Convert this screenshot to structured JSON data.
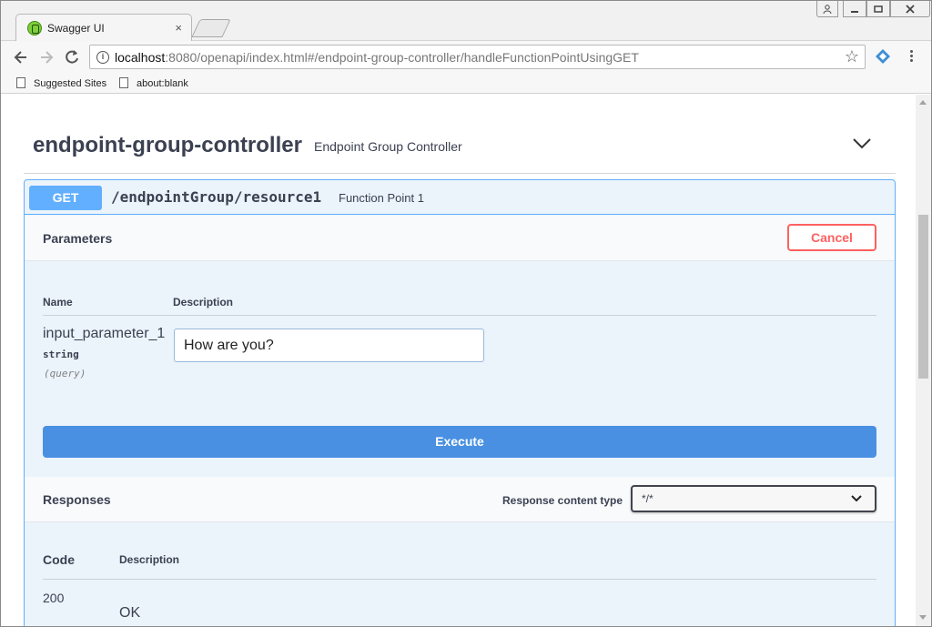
{
  "browser": {
    "tab_title": "Swagger UI",
    "tab_close": "×",
    "url_host": "localhost",
    "url_rest": ":8080/openapi/index.html#/endpoint-group-controller/handleFunctionPointUsingGET",
    "bookmarks": [
      "Suggested Sites",
      "about:blank"
    ]
  },
  "section": {
    "title": "endpoint-group-controller",
    "description": "Endpoint Group Controller"
  },
  "operation": {
    "method": "GET",
    "path": "/endpointGroup/resource1",
    "summary": "Function Point 1"
  },
  "parameters": {
    "title": "Parameters",
    "cancel_label": "Cancel",
    "columns": {
      "name": "Name",
      "description": "Description"
    },
    "items": [
      {
        "name": "input_parameter_1",
        "type": "string",
        "in": "(query)",
        "value": "How are you?"
      }
    ]
  },
  "execute_label": "Execute",
  "responses": {
    "title": "Responses",
    "content_type_label": "Response content type",
    "content_type_value": "*/*",
    "columns": {
      "code": "Code",
      "description": "Description"
    },
    "items": [
      {
        "code": "200",
        "description": "OK"
      }
    ]
  },
  "colors": {
    "get_method": "#61affe",
    "execute": "#4990e2",
    "cancel": "#ff6060",
    "text": "#3b4151"
  }
}
